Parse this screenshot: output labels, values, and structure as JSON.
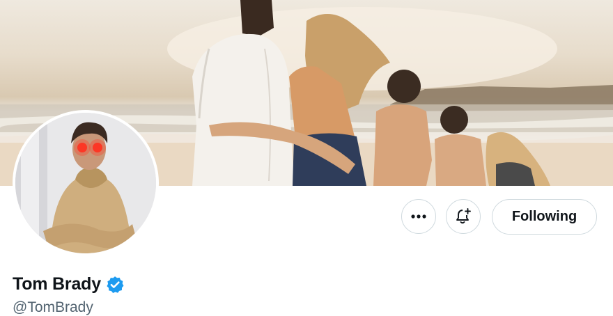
{
  "profile": {
    "display_name": "Tom Brady",
    "handle": "@TomBrady",
    "verified": true
  },
  "actions": {
    "more_icon": "more-horizontal-icon",
    "notify_icon": "bell-plus-icon",
    "follow_state_label": "Following"
  },
  "colors": {
    "verified_badge": "#1d9bf0",
    "text_primary": "#0f1419",
    "text_secondary": "#536471",
    "button_border": "#cfd9de"
  }
}
